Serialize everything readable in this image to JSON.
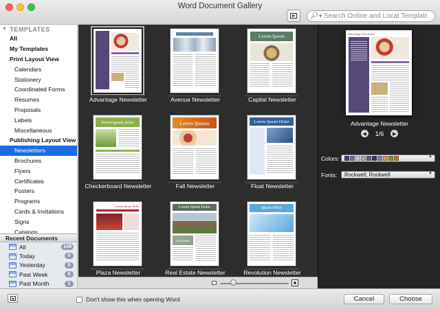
{
  "window": {
    "title": "Word Document Gallery"
  },
  "search": {
    "placeholder": "Search Online and Local Templates"
  },
  "sidebar": {
    "header": "TEMPLATES",
    "items": [
      {
        "label": "All",
        "level": 1
      },
      {
        "label": "My Templates",
        "level": 1
      },
      {
        "label": "Print Layout View",
        "level": 1
      },
      {
        "label": "Calendars",
        "level": 2
      },
      {
        "label": "Stationery",
        "level": 2
      },
      {
        "label": "Coordinated Forms",
        "level": 2
      },
      {
        "label": "Resumes",
        "level": 2
      },
      {
        "label": "Proposals",
        "level": 2
      },
      {
        "label": "Labels",
        "level": 2
      },
      {
        "label": "Miscellaneous",
        "level": 2
      },
      {
        "label": "Publishing Layout View",
        "level": 1
      },
      {
        "label": "Newsletters",
        "level": 2,
        "selected": true
      },
      {
        "label": "Brochures",
        "level": 2
      },
      {
        "label": "Flyers",
        "level": 2
      },
      {
        "label": "Certificates",
        "level": 2
      },
      {
        "label": "Posters",
        "level": 2
      },
      {
        "label": "Programs",
        "level": 2
      },
      {
        "label": "Cards & Invitations",
        "level": 2
      },
      {
        "label": "Signs",
        "level": 2
      },
      {
        "label": "Catalogs",
        "level": 2
      }
    ]
  },
  "recent": {
    "header": "Recent Documents",
    "items": [
      {
        "label": "All",
        "count": "149"
      },
      {
        "label": "Today",
        "count": "0"
      },
      {
        "label": "Yesterday",
        "count": "0"
      },
      {
        "label": "Past Week",
        "count": "0"
      },
      {
        "label": "Past Month",
        "count": "1"
      }
    ]
  },
  "gallery": {
    "templates": [
      {
        "name": "Advantage Newsletter",
        "selected": true
      },
      {
        "name": "Avenue Newsletter"
      },
      {
        "name": "Capital Newsletter"
      },
      {
        "name": "Checkerboard Newsletter"
      },
      {
        "name": "Fall Newsletter"
      },
      {
        "name": "Float Newsletter"
      },
      {
        "name": "Plaza Newsletter"
      },
      {
        "name": "Real Estate Newsletter"
      },
      {
        "name": "Revolution Newsletter"
      }
    ],
    "thumb_text": {
      "lorem_ipsum": "Lorem Ipsum",
      "lorem_ipsum_dolor": "Lorem Ipsum Dolor",
      "lorem_ipsums": "Lorem Ipsums",
      "lorem_ipsum_dolor_lc": "lorem ipsum dolor",
      "ipsum_dolor": "Ipsum Dolor",
      "sed_justo": "Sed justo"
    }
  },
  "preview": {
    "name": "Advantage Newsletter",
    "page": "1/6",
    "colors_label": "Colors:",
    "fonts_label": "Fonts:",
    "fonts_value": "Rockwell; Rockwell",
    "swatches": [
      "#4b3e6e",
      "#7a6aa0",
      "#c9c3d9",
      "#a9a9a9",
      "#6e5a88",
      "#3a3a55",
      "#8a7bb3",
      "#c99a3d",
      "#7f8f3a",
      "#b07a2d"
    ]
  },
  "footer": {
    "checkbox_label": "Don't show this when opening Word",
    "cancel": "Cancel",
    "choose": "Choose"
  }
}
